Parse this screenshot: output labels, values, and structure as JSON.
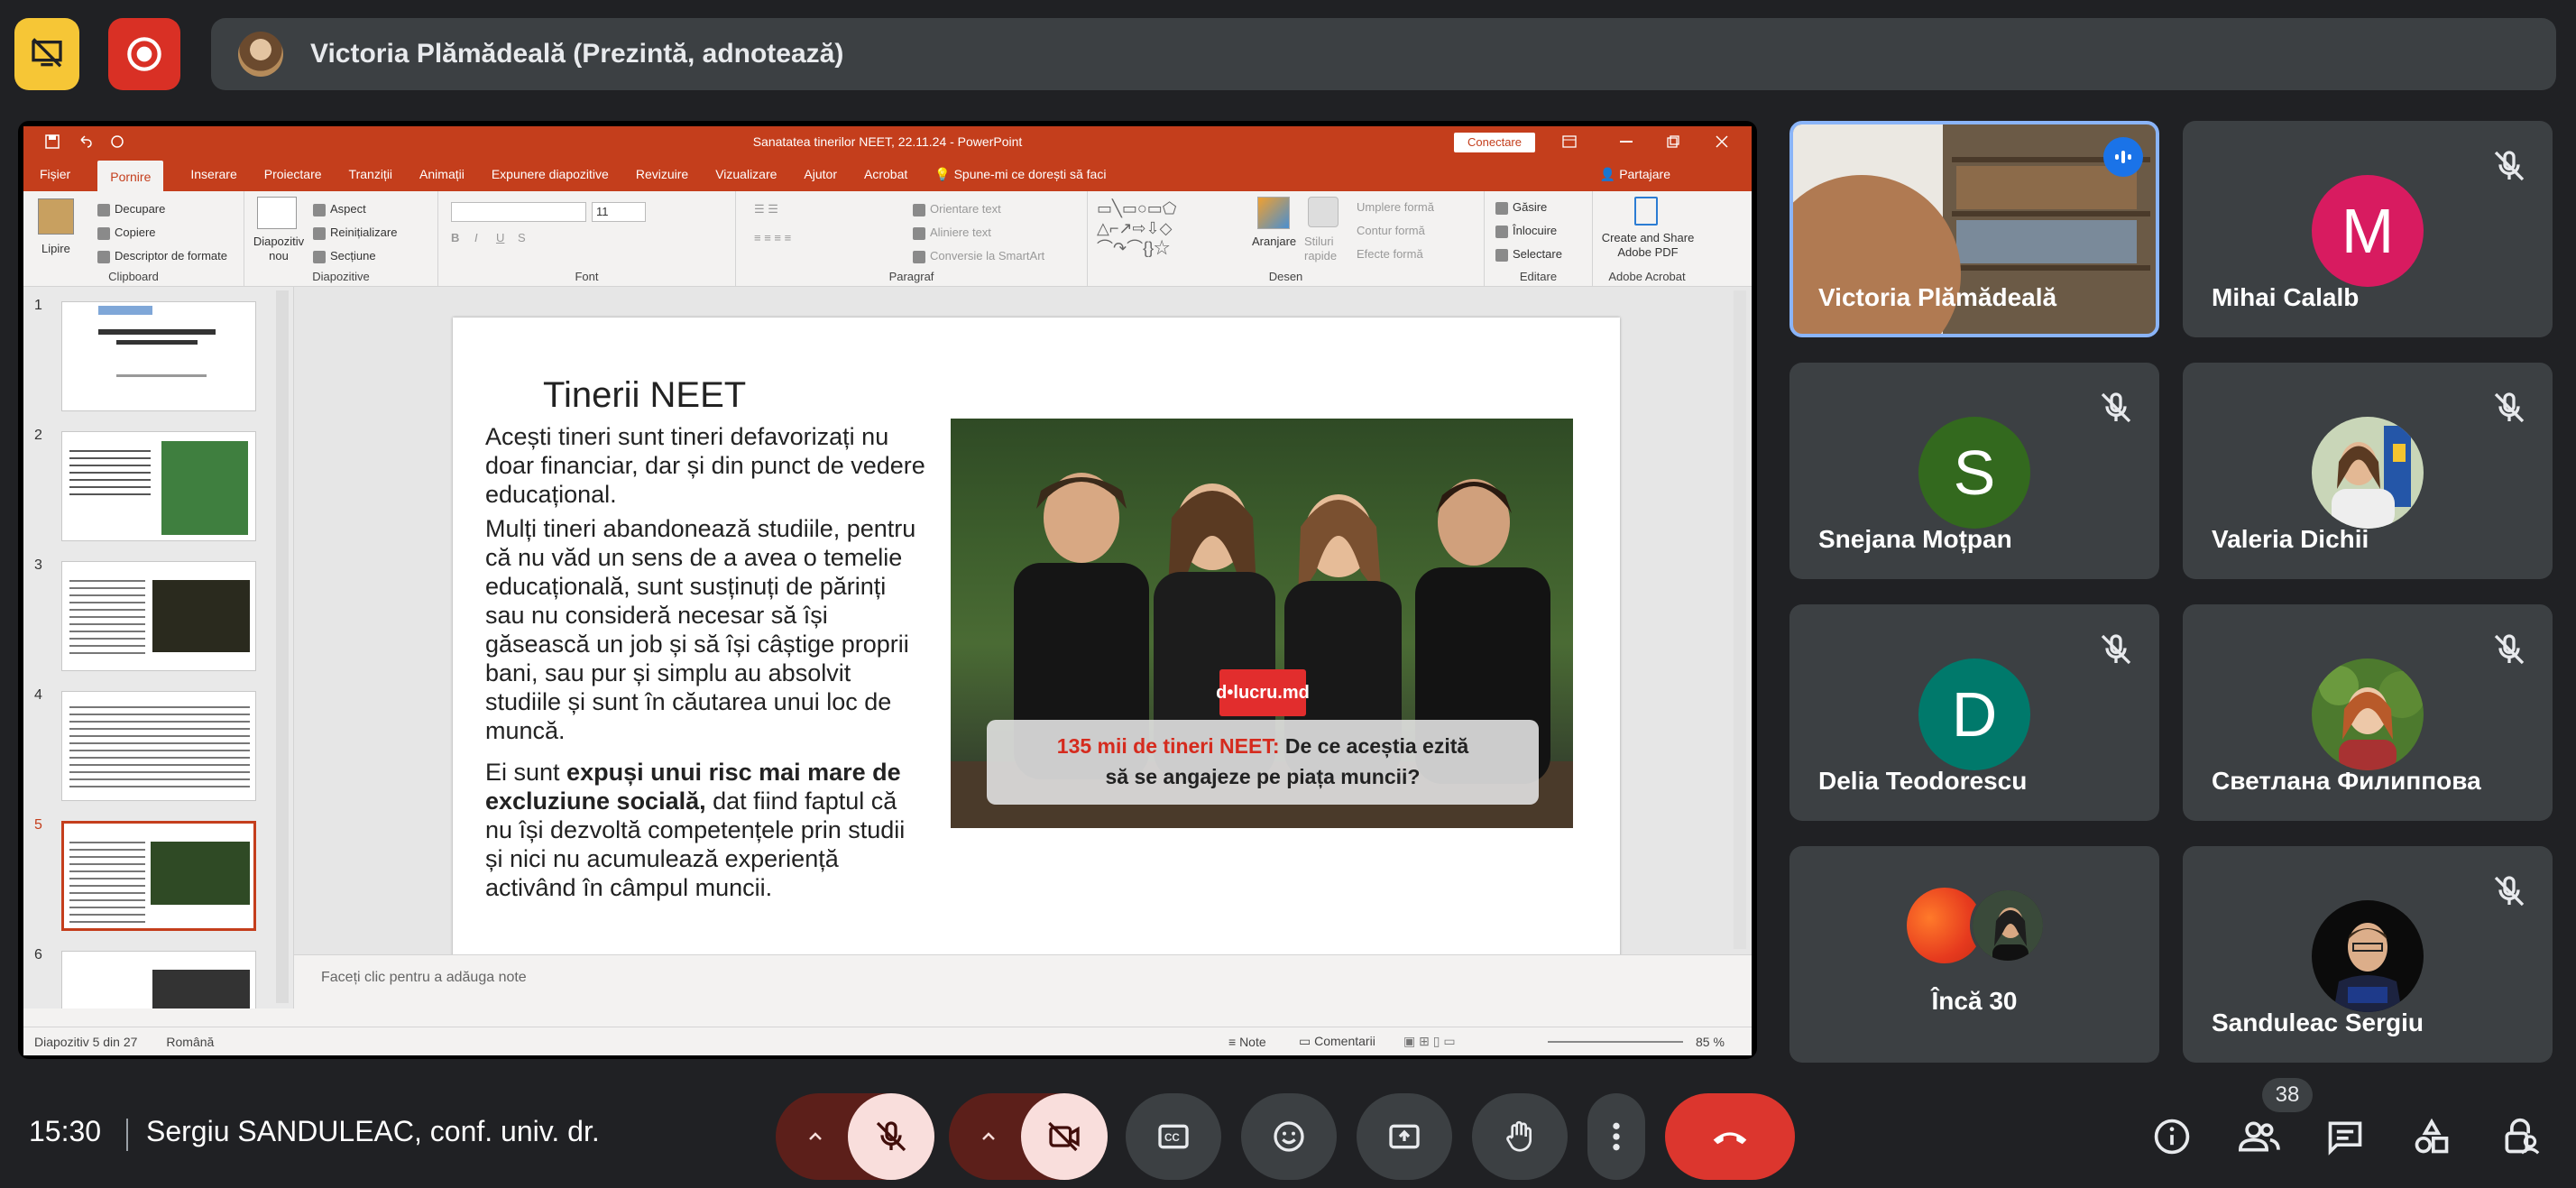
{
  "top_bar": {
    "presenter_text": "Victoria Plămădeală (Prezintă, adnotează)"
  },
  "ppt": {
    "title": "Sanatatea tinerilor NEET, 22.11.24 - PowerPoint",
    "connect": "Conectare",
    "menu": [
      "Fișier",
      "Pornire",
      "Inserare",
      "Proiectare",
      "Tranziții",
      "Animații",
      "Expunere diapozitive",
      "Revizuire",
      "Vizualizare",
      "Ajutor",
      "Acrobat",
      "Spune-mi ce dorești să faci"
    ],
    "share": "Partajare",
    "ribbon": {
      "clipboard": {
        "label": "Clipboard",
        "paste": "Lipire",
        "cut": "Decupare",
        "copy": "Copiere",
        "format": "Descriptor de formate"
      },
      "slides": {
        "label": "Diapozitive",
        "new": "Diapozitiv nou",
        "layout": "Aspect",
        "reset": "Reinițializare",
        "section": "Secțiune"
      },
      "font": {
        "label": "Font",
        "size": "11"
      },
      "paragraph": {
        "label": "Paragraf",
        "direction": "Orientare text",
        "align": "Aliniere text",
        "smartart": "Conversie la SmartArt"
      },
      "drawing": {
        "label": "Desen",
        "arrange": "Aranjare",
        "styles": "Stiluri rapide",
        "fill": "Umplere formă",
        "outline": "Contur formă",
        "effects": "Efecte formă"
      },
      "editing": {
        "label": "Editare",
        "find": "Găsire",
        "replace": "Înlocuire",
        "select": "Selectare"
      },
      "acrobat": {
        "label": "Adobe Acrobat",
        "create": "Create and Share Adobe PDF"
      }
    },
    "thumbs": [
      "1",
      "2",
      "3",
      "4",
      "5",
      "6"
    ],
    "slide": {
      "title": "Tinerii NEET",
      "p1": "Acești tineri sunt tineri defavorizați nu doar financiar, dar și din punct de vedere educațional.",
      "p2": "Mulți tineri abandonează studiile, pentru că nu văd un sens de a avea o temelie educațională, sunt susținuți de părinți sau nu consideră necesar să își găsească un job și să își câștige proprii bani, sau pur și simplu au absolvit studiile și sunt în căutarea unui loc de muncă.",
      "p3_prefix": "Ei sunt ",
      "p3_bold": "expuși unui risc mai mare de excluziune socială,",
      "p3_suffix": " dat fiind faptul că nu își dezvoltă competențele prin studii și nici nu acumulează experiență activând în câmpul muncii.",
      "photo_logo": "d•lucru.md",
      "caption_red": "135 mii de tineri NEET:",
      "caption_rest": " De ce aceștia ezită",
      "caption_line2": "să se angajeze pe piața muncii?"
    },
    "notes_placeholder": "Faceți clic pentru a adăuga note",
    "status": {
      "slide": "Diapozitiv 5 din 27",
      "lang": "Română",
      "notes": "Note",
      "comments": "Comentarii",
      "zoom": "85 %"
    }
  },
  "participants": [
    {
      "name": "Victoria Plămădeală",
      "type": "video",
      "speaking": true
    },
    {
      "name": "Mihai Calalb",
      "letter": "M",
      "color": "#d81b60",
      "muted": true
    },
    {
      "name": "Snejana Moțpan",
      "letter": "S",
      "color": "#33691e",
      "muted": true
    },
    {
      "name": "Valeria Dichii",
      "type": "photo",
      "muted": true
    },
    {
      "name": "Delia Teodorescu",
      "letter": "D",
      "color": "#00796b",
      "muted": true
    },
    {
      "name": "Светлана Филиппова",
      "type": "photo",
      "muted": true
    },
    {
      "name": "Încă 30",
      "type": "more"
    },
    {
      "name": "Sanduleac Sergiu",
      "type": "photo",
      "muted": true
    }
  ],
  "bottom_bar": {
    "time": "15:30",
    "meeting": "Sergiu SANDULEAC, conf. univ. dr.",
    "people_count": "38"
  },
  "colors": {
    "bg": "#202124",
    "tile": "#3c4043",
    "accent_red": "#dc362e",
    "ppt_brand": "#c43e1c",
    "speaking": "#8ab4f8"
  }
}
